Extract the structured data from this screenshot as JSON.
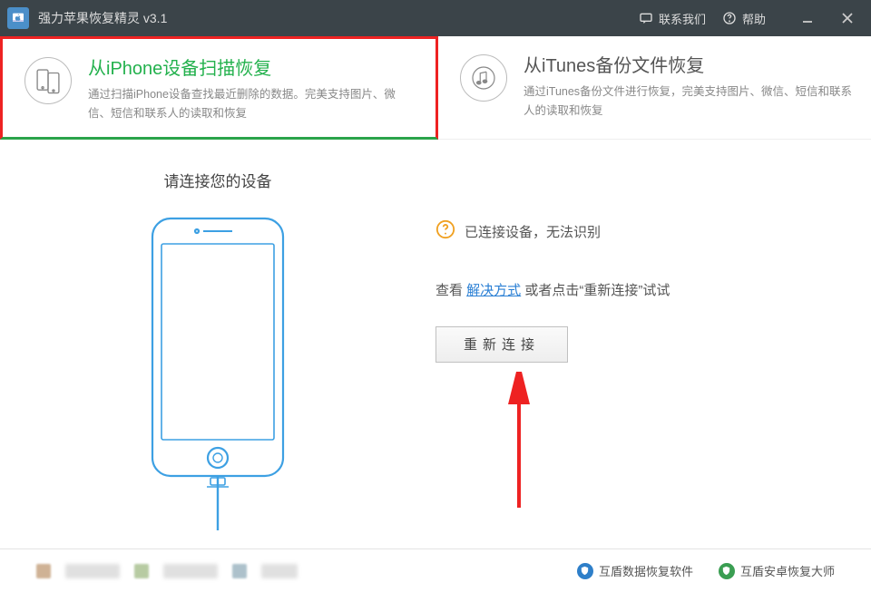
{
  "titlebar": {
    "app_name": "强力苹果恢复精灵 v3.1",
    "contact": "联系我们",
    "help": "帮助"
  },
  "modes": {
    "iphone": {
      "title": "从iPhone设备扫描恢复",
      "desc": "通过扫描iPhone设备查找最近删除的数据。完美支持图片、微信、短信和联系人的读取和恢复"
    },
    "itunes": {
      "title": "从iTunes备份文件恢复",
      "desc": "通过iTunes备份文件进行恢复，完美支持图片、微信、短信和联系人的读取和恢复"
    }
  },
  "main": {
    "prompt": "请连接您的设备",
    "status": "已连接设备，无法识别",
    "hint_pre": "查看 ",
    "hint_link": "解决方式",
    "hint_post": " 或者点击“重新连接”试试",
    "retry": "重新连接"
  },
  "footer": {
    "link1": "互盾数据恢复软件",
    "link2": "互盾安卓恢复大师"
  }
}
